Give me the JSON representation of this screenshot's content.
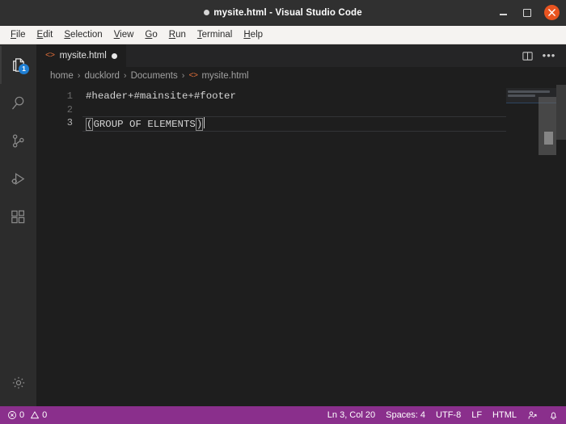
{
  "window": {
    "title": "mysite.html - Visual Studio Code",
    "dirty_indicator": "●",
    "controls": {
      "minimize": "minimize-button",
      "maximize": "maximize-button",
      "close": "close-button"
    }
  },
  "menubar": {
    "items": [
      {
        "label": "File",
        "mnemonic": "F"
      },
      {
        "label": "Edit",
        "mnemonic": "E"
      },
      {
        "label": "Selection",
        "mnemonic": "S"
      },
      {
        "label": "View",
        "mnemonic": "V"
      },
      {
        "label": "Go",
        "mnemonic": "G"
      },
      {
        "label": "Run",
        "mnemonic": "R"
      },
      {
        "label": "Terminal",
        "mnemonic": "T"
      },
      {
        "label": "Help",
        "mnemonic": "H"
      }
    ]
  },
  "activitybar": {
    "items": [
      {
        "name": "explorer",
        "icon": "files-icon",
        "badge": "1",
        "active": true
      },
      {
        "name": "search",
        "icon": "search-icon",
        "badge": "",
        "active": false
      },
      {
        "name": "source-control",
        "icon": "source-control-icon",
        "badge": "",
        "active": false
      },
      {
        "name": "run-and-debug",
        "icon": "run-debug-icon",
        "badge": "",
        "active": false
      },
      {
        "name": "extensions",
        "icon": "extensions-icon",
        "badge": "",
        "active": false
      }
    ],
    "bottom": [
      {
        "name": "manage",
        "icon": "gear-icon"
      }
    ]
  },
  "tabs": {
    "active_tab": {
      "label": "mysite.html",
      "icon": "html-file-icon",
      "icon_glyph": "<>",
      "dirty": true
    },
    "actions": {
      "split_editor": "split-editor-icon",
      "more_actions": "•••"
    }
  },
  "breadcrumbs": {
    "separator": "›",
    "items": [
      {
        "label": "home",
        "icon": ""
      },
      {
        "label": "ducklord",
        "icon": ""
      },
      {
        "label": "Documents",
        "icon": ""
      },
      {
        "label": "mysite.html",
        "icon": "html-file-icon",
        "icon_glyph": "<>"
      }
    ]
  },
  "editor": {
    "lines": [
      {
        "number": "1",
        "text": "#header+#mainsite+#footer",
        "current": false
      },
      {
        "number": "2",
        "text": "",
        "current": false
      },
      {
        "number": "3",
        "text": "(GROUP OF ELEMENTS)",
        "current": true
      }
    ],
    "line3": {
      "open_bracket": "(",
      "content": "GROUP OF ELEMENTS",
      "close_bracket": ")"
    }
  },
  "statusbar": {
    "errors_icon": "error-icon",
    "errors_count": "0",
    "warnings_icon": "warning-icon",
    "warnings_count": "0",
    "cursor_position": "Ln 3, Col 20",
    "indentation": "Spaces: 4",
    "encoding": "UTF-8",
    "eol": "LF",
    "language": "HTML",
    "feedback_icon": "feedback-icon",
    "bell_icon": "bell-icon"
  },
  "colors": {
    "titlebar_bg": "#303030",
    "menubar_bg": "#f5f3f1",
    "activitybar_bg": "#2c2c2c",
    "editor_bg": "#1e1e1e",
    "tabbar_bg": "#252526",
    "statusbar_bg": "#8a2f8c",
    "accent_orange": "#e95420",
    "html_icon": "#e4703a",
    "badge_blue": "#1f7fd4"
  }
}
